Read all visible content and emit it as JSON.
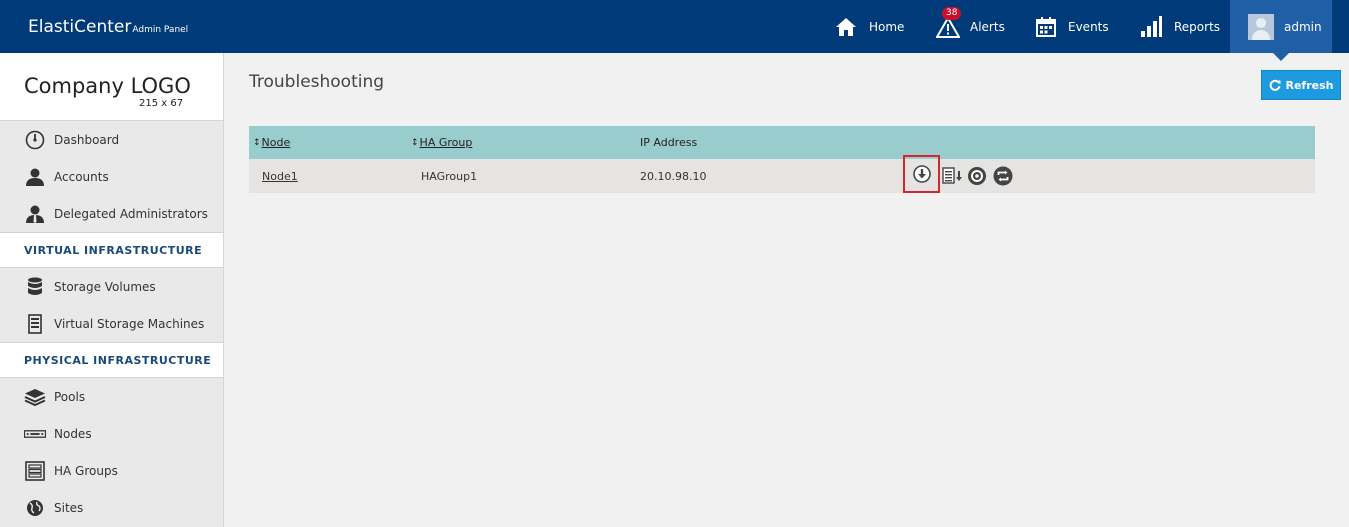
{
  "brand": {
    "name": "ElastiCenter",
    "subtitle": "Admin Panel"
  },
  "nav": {
    "home": "Home",
    "alerts": "Alerts",
    "alerts_count": "38",
    "events": "Events",
    "reports": "Reports",
    "user": "admin"
  },
  "sidebar": {
    "logo_title": "Company LOGO",
    "logo_size": "215 x 67",
    "items": [
      {
        "label": "Dashboard",
        "icon": "gauge-icon"
      },
      {
        "label": "Accounts",
        "icon": "user-icon"
      },
      {
        "label": "Delegated Administrators",
        "icon": "admin-user-icon"
      }
    ],
    "section_virtual": "VIRTUAL INFRASTRUCTURE",
    "virtual_items": [
      {
        "label": "Storage Volumes",
        "icon": "database-icon"
      },
      {
        "label": "Virtual Storage Machines",
        "icon": "server-icon"
      }
    ],
    "section_physical": "PHYSICAL INFRASTRUCTURE",
    "physical_items": [
      {
        "label": "Pools",
        "icon": "layers-icon"
      },
      {
        "label": "Nodes",
        "icon": "node-icon"
      },
      {
        "label": "HA Groups",
        "icon": "ha-group-icon"
      },
      {
        "label": "Sites",
        "icon": "globe-icon"
      }
    ]
  },
  "main": {
    "title": "Troubleshooting",
    "refresh_label": "Refresh",
    "table": {
      "headers": {
        "node": "Node",
        "ha_group": "HA Group",
        "ip": "IP Address"
      },
      "rows": [
        {
          "node": "Node1",
          "ha_group": "HAGroup1",
          "ip": "20.10.98.10"
        }
      ]
    }
  },
  "colors": {
    "topbar": "#003a78",
    "user_tab": "#1f5fa6",
    "accent": "#1e9be0",
    "table_header": "#99cccc",
    "highlight": "#d9262c"
  }
}
